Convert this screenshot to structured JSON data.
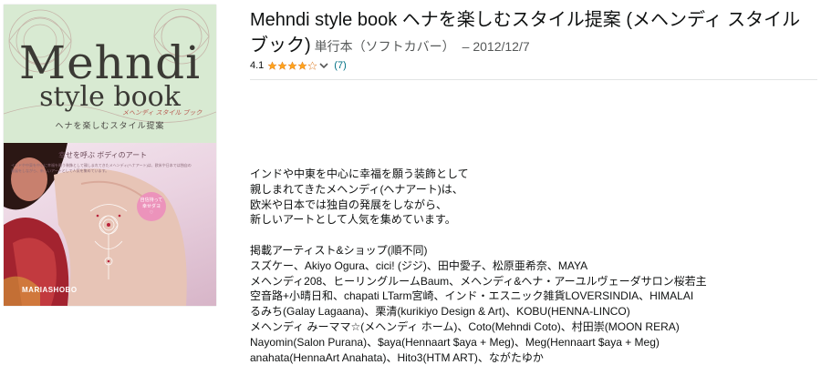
{
  "cover": {
    "title": "Mehndi",
    "subtitle": "style book",
    "subtitle_kana": "メヘンディ スタイル ブック",
    "catchphrase": "ヘナを楽しむスタイル提案",
    "photo_heading": "幸せを呼ぶ ボディのアート",
    "photo_small_text": "インドや中東を中心に幸福を願う装飾として親しまれてきたメヘンディ(ヘナアート)は、欧米や日本では独自の発展をしながら、新しいアートとして人気を集めています。",
    "badge_line1": "自信持って",
    "badge_line2": "幸せダヨ",
    "badge_heart": "♡",
    "publisher": "MARIASHOBO"
  },
  "product": {
    "title": "Mehndi style book ヘナを楽しむスタイル提案 (メヘンディ スタイルブック)",
    "format": "単行本（ソフトカバー）",
    "date": "– 2012/12/7",
    "rating": "4.1",
    "stars_filled": 4,
    "review_count": "(7)"
  },
  "description": {
    "intro_lines": [
      "インドや中東を中心に幸福を願う装飾として",
      "親しまれてきたメヘンディ(ヘナアート)は、",
      "欧米や日本では独自の発展をしながら、",
      "新しいアートとして人気を集めています。"
    ],
    "artists_lines": [
      "掲載アーティスト&ショップ(順不同)",
      "スズケー、Akiyo Ogura、cici! (ジジ)、田中愛子、松原亜希奈、MAYA",
      "メヘンディ208、ヒーリングルームBaum、メヘンディ&ヘナ・アーユルヴェーダサロン桜若主",
      "空音路+小晴日和、chapati LTarm宮崎、インド・エスニック雑貨LOVERSINDIA、HIMALAI",
      "るみち(Galay Lagaana)、栗清(kurikiyo Design & Art)、KOBU(HENNA-LINCO)",
      "メヘンディ みーママ☆(メヘンディ ホーム)、Coto(Mehndi Coto)、村田崇(MOON RERA)",
      "Nayomin(Salon Purana)、$aya(Hennaart $aya + Meg)、Meg(Hennaart $aya + Meg)",
      "anahata(HennaArt Anahata)、Hito3(HTM ART)、ながたゆか"
    ]
  },
  "colors": {
    "link": "#007185",
    "star": "#ffa41c",
    "cover_green": "#d8ead2",
    "cover_pink": "#ec93bb"
  }
}
